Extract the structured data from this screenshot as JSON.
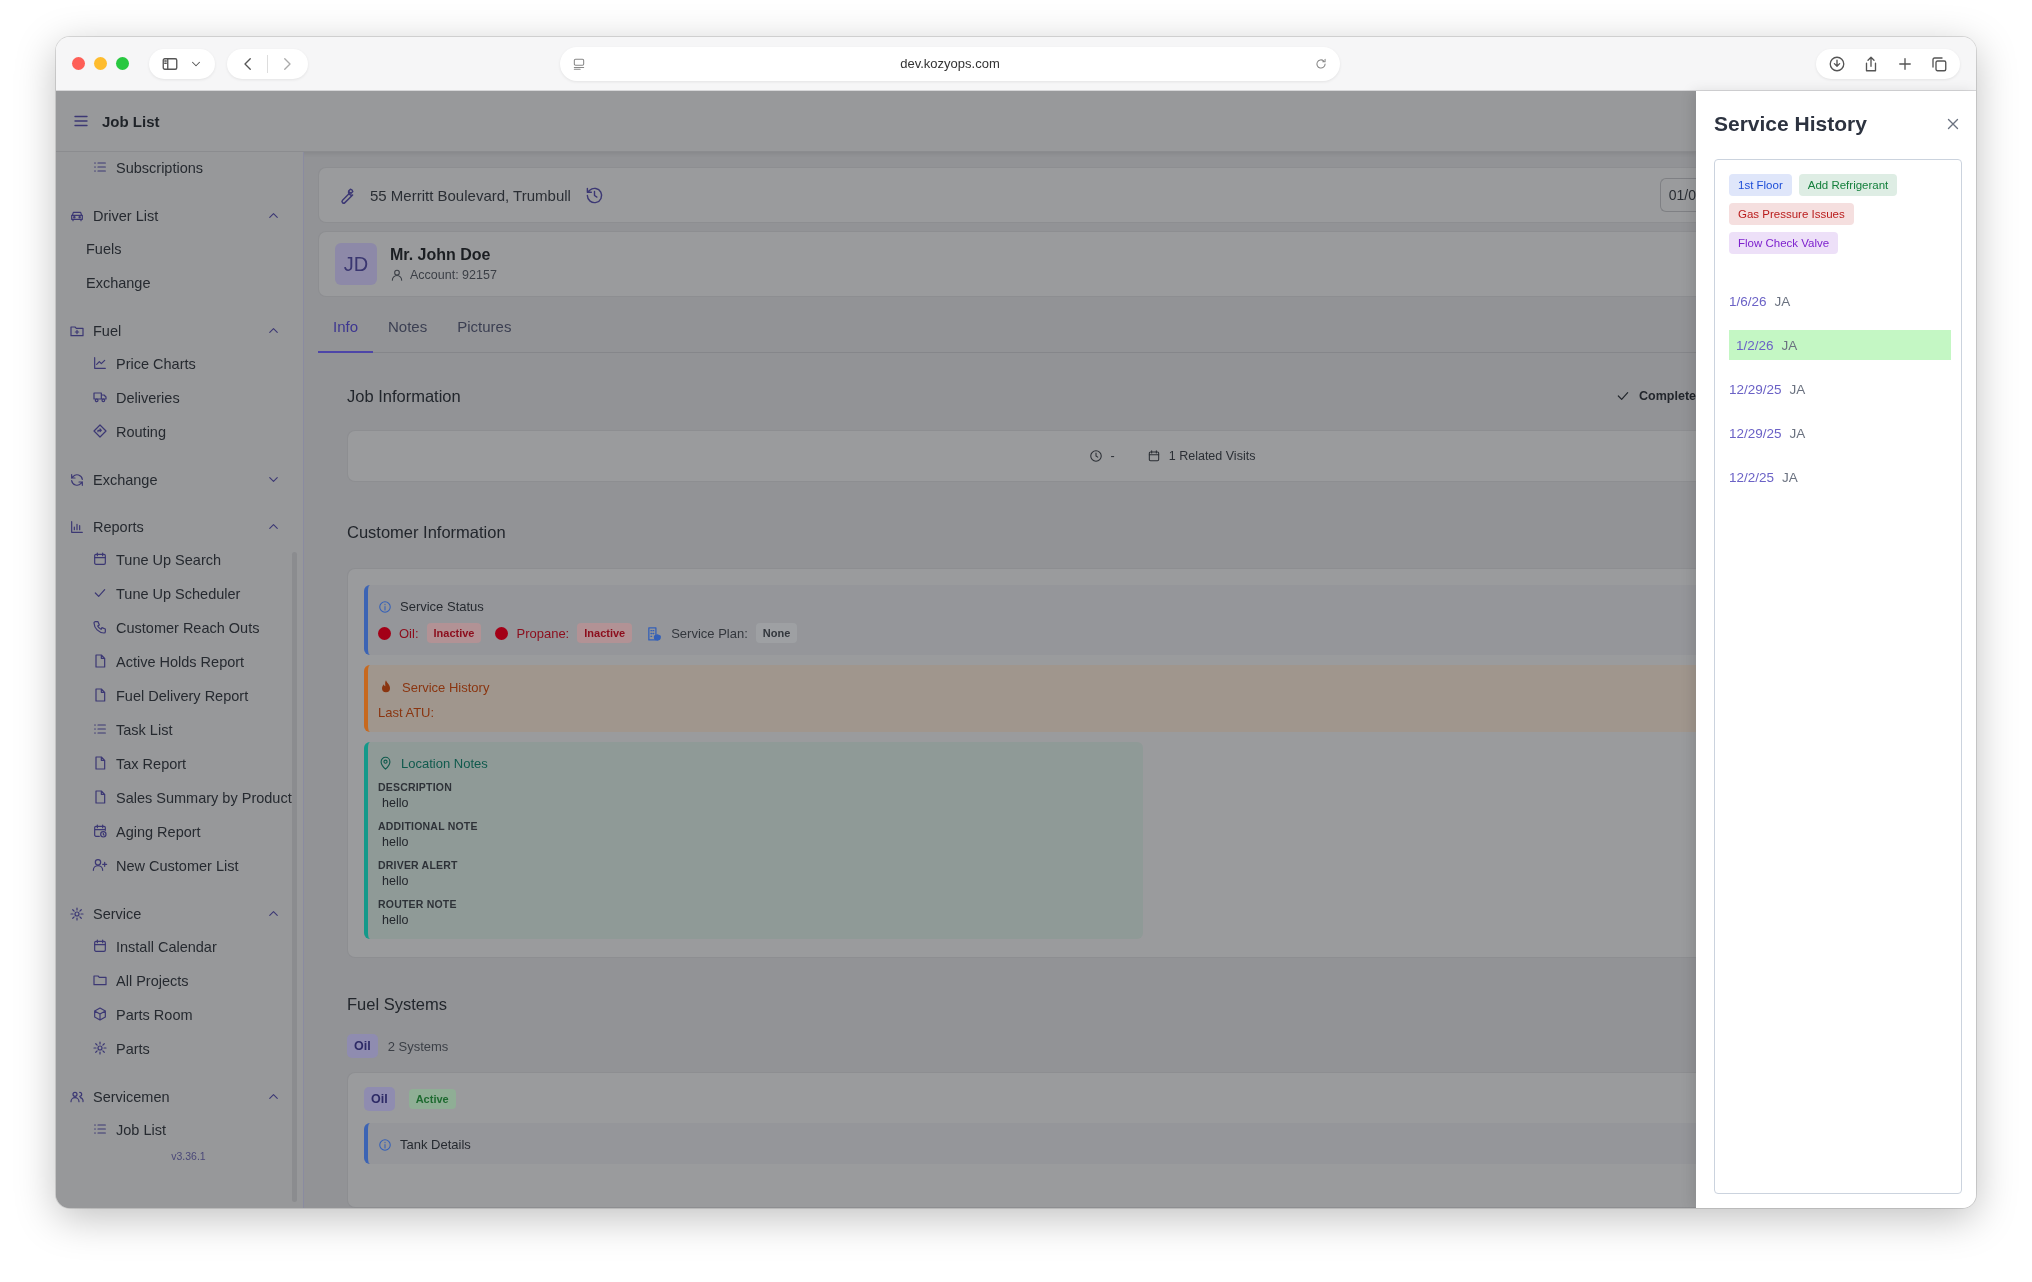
{
  "browser": {
    "url": "dev.kozyops.com"
  },
  "header": {
    "title": "Job List"
  },
  "sidebar": {
    "partial_item": "Subscriptions",
    "groups": [
      {
        "label": "Driver List",
        "expanded": true,
        "children": [
          {
            "label": "Fuels"
          },
          {
            "label": "Exchange"
          }
        ]
      },
      {
        "label": "Fuel",
        "expanded": true,
        "children": [
          {
            "label": "Price Charts"
          },
          {
            "label": "Deliveries"
          },
          {
            "label": "Routing"
          }
        ]
      },
      {
        "label": "Exchange",
        "expanded": false
      },
      {
        "label": "Reports",
        "expanded": true,
        "children": [
          {
            "label": "Tune Up Search"
          },
          {
            "label": "Tune Up Scheduler"
          },
          {
            "label": "Customer Reach Outs"
          },
          {
            "label": "Active Holds Report"
          },
          {
            "label": "Fuel Delivery Report"
          },
          {
            "label": "Task List"
          },
          {
            "label": "Tax Report"
          },
          {
            "label": "Sales Summary by Product"
          },
          {
            "label": "Aging Report"
          },
          {
            "label": "New Customer List"
          }
        ]
      },
      {
        "label": "Service",
        "expanded": true,
        "children": [
          {
            "label": "Install Calendar"
          },
          {
            "label": "All Projects"
          },
          {
            "label": "Parts Room"
          },
          {
            "label": "Parts"
          }
        ]
      },
      {
        "label": "Servicemen",
        "expanded": true,
        "children": [
          {
            "label": "Job List"
          }
        ]
      }
    ],
    "version": "v3.36.1"
  },
  "job": {
    "address": "55 Merritt Boulevard, Trumbull",
    "date": "01/0",
    "customer": {
      "initials": "JD",
      "name": "Mr. John Doe",
      "account": "Account: 92157"
    }
  },
  "tabs": [
    {
      "label": "Info",
      "selected": true
    },
    {
      "label": "Notes",
      "selected": false
    },
    {
      "label": "Pictures",
      "selected": false
    }
  ],
  "job_information": {
    "title": "Job Information",
    "status": "Complete",
    "time": "-",
    "related": "1 Related Visits"
  },
  "customer_information": {
    "title": "Customer Information",
    "service_status": {
      "title": "Service Status",
      "fuels": [
        {
          "label": "Oil:",
          "status": "Inactive"
        },
        {
          "label": "Propane:",
          "status": "Inactive"
        }
      ],
      "plan_label": "Service Plan:",
      "plan": "None"
    },
    "service_history": {
      "title": "Service History",
      "last_atu": "Last ATU:"
    },
    "location_notes": {
      "title": "Location Notes",
      "fields": [
        {
          "label": "DESCRIPTION",
          "value": "hello"
        },
        {
          "label": "ADDITIONAL NOTE",
          "value": "hello"
        },
        {
          "label": "DRIVER ALERT",
          "value": "hello"
        },
        {
          "label": "ROUTER NOTE",
          "value": "hello"
        }
      ]
    }
  },
  "fuel_systems": {
    "title": "Fuel Systems",
    "filter": "Oil",
    "count": "2 Systems",
    "systems": [
      {
        "type": "Oil",
        "status": "Active",
        "tank_title": "Tank Details"
      }
    ]
  },
  "panel": {
    "title": "Service History",
    "tags": [
      {
        "label": "1st Floor",
        "color": "#1d4ed8"
      },
      {
        "label": "Add Refrigerant",
        "color": "#15803d"
      },
      {
        "label": "Gas Pressure Issues",
        "color": "#b91c1c"
      },
      {
        "label": "Flow Check Valve",
        "color": "#7e22ce"
      }
    ],
    "entries": [
      {
        "date": "1/6/26",
        "initials": "JA",
        "selected": false
      },
      {
        "date": "1/2/26",
        "initials": "JA",
        "selected": true
      },
      {
        "date": "12/29/25",
        "initials": "JA",
        "selected": false
      },
      {
        "date": "12/29/25",
        "initials": "JA",
        "selected": false
      },
      {
        "date": "12/2/25",
        "initials": "JA",
        "selected": false
      }
    ]
  }
}
